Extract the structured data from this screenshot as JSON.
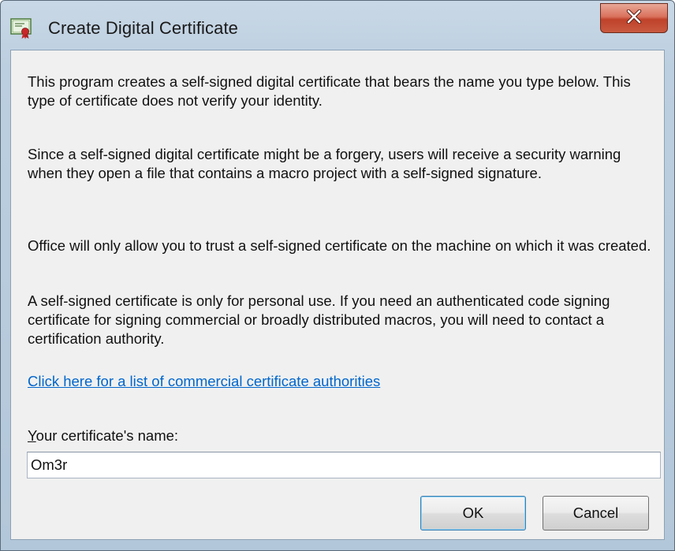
{
  "window": {
    "title": "Create Digital Certificate",
    "title_icon": "certificate-icon",
    "close_icon": "close-x-icon",
    "accent_close": "#c74e34"
  },
  "content": {
    "paragraphs": [
      "This program creates a self-signed digital certificate that bears the name you type below. This type of certificate does not verify your identity.",
      "Since a self-signed digital certificate might be a forgery, users will receive a security warning when they open a file that contains a macro project with a self-signed signature.",
      "Office will only allow you to trust a self-signed certificate on the machine on which it was created.",
      "A self-signed certificate is only for personal use. If you need an authenticated code signing certificate for signing commercial or broadly distributed macros, you will need to contact a certification authority."
    ],
    "link_text": "Click here for a list of commercial certificate authorities",
    "link_color": "#0066cc",
    "name_label": "Your certificate's name:",
    "name_value": "Om3r"
  },
  "buttons": {
    "ok_label": "OK",
    "cancel_label": "Cancel"
  }
}
